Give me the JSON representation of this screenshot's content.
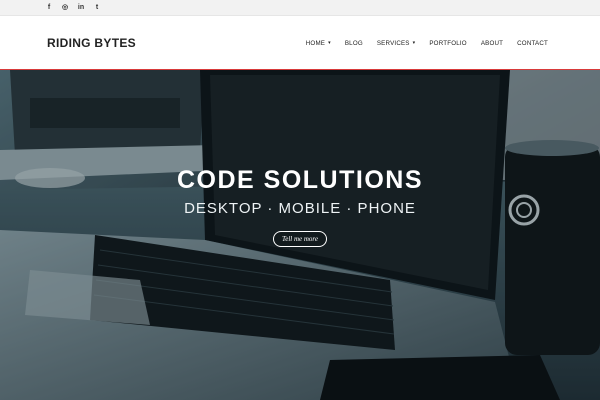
{
  "social": {
    "facebook": {
      "icon": "facebook-icon",
      "glyph": "f"
    },
    "github": {
      "icon": "github-icon",
      "glyph": "◎"
    },
    "linkedin": {
      "icon": "linkedin-icon",
      "glyph": "in"
    },
    "twitter": {
      "icon": "twitter-icon",
      "glyph": "t"
    }
  },
  "header": {
    "brand": "RIDING BYTES",
    "nav": {
      "home": "HOME",
      "blog": "BLOG",
      "services": "SERVICES",
      "portfolio": "PORTFOLIO",
      "about": "ABOUT",
      "contact": "CONTACT"
    },
    "caret": "▾"
  },
  "hero": {
    "title": "CODE SOLUTIONS",
    "subtitle": "DESKTOP · MOBILE · PHONE",
    "cta": "Tell me more"
  },
  "colors": {
    "accent_line": "#d83a3a",
    "hero_tint": "#1e2a30"
  }
}
